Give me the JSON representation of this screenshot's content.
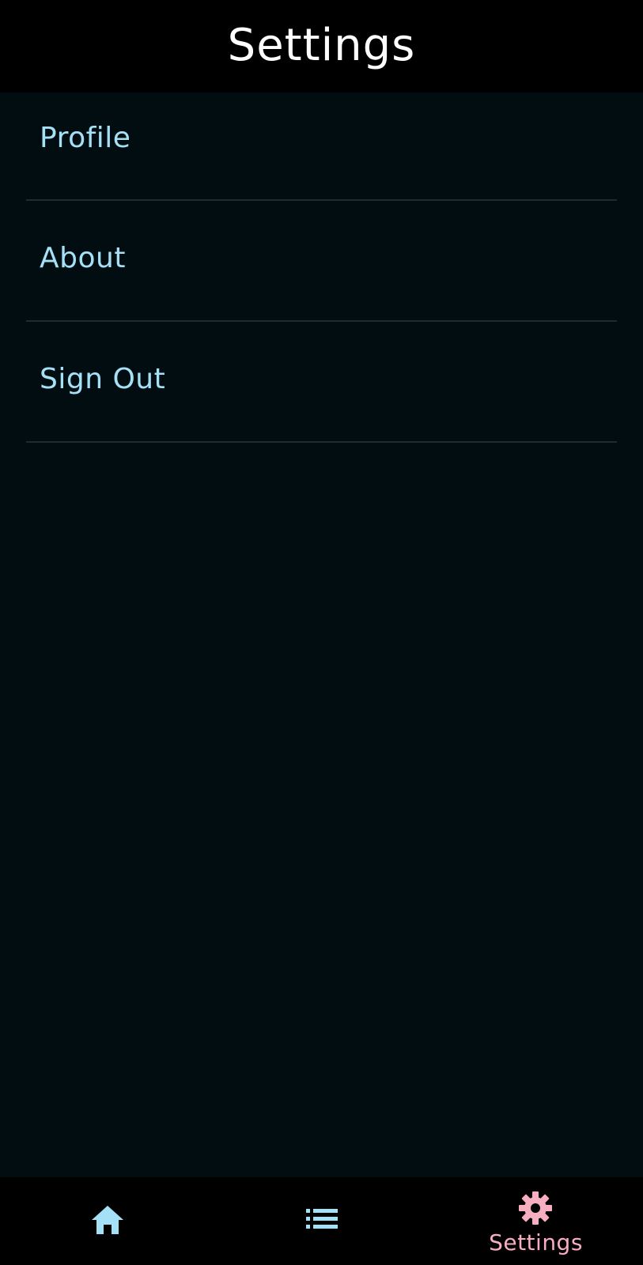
{
  "header": {
    "title": "Settings"
  },
  "menu": {
    "items": [
      {
        "label": "Profile"
      },
      {
        "label": "About"
      },
      {
        "label": "Sign Out"
      }
    ]
  },
  "bottom_nav": {
    "items": [
      {
        "icon": "home-icon",
        "label": "",
        "active": false
      },
      {
        "icon": "list-icon",
        "label": "",
        "active": false
      },
      {
        "icon": "gear-icon",
        "label": "Settings",
        "active": true
      }
    ]
  },
  "colors": {
    "background": "#020d11",
    "bar": "#000000",
    "accent": "#a5e1f6",
    "active": "#f7aec1",
    "divider": "#1f2b31"
  }
}
